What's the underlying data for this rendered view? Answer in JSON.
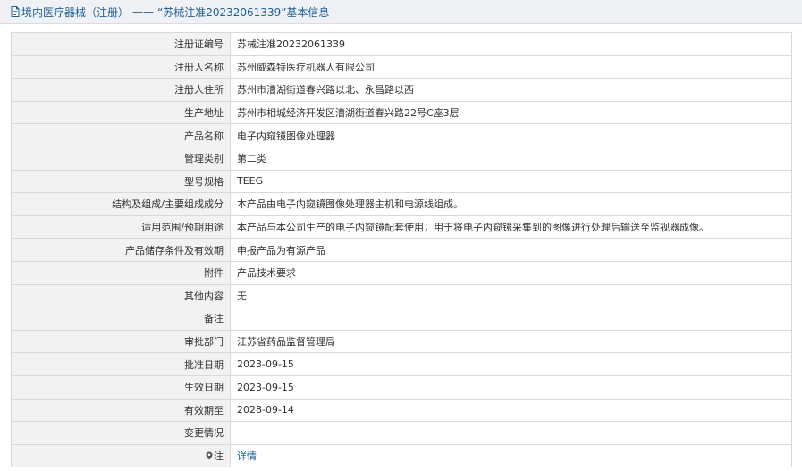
{
  "header": {
    "category": "境内医疗器械（注册）",
    "separator": "——",
    "title": "“苏械注准20232061339”基本信息",
    "icon": "document-icon"
  },
  "rows": [
    {
      "key": "registration-number",
      "label": "注册证编号",
      "value": "苏械注准20232061339"
    },
    {
      "key": "registrant-name",
      "label": "注册人名称",
      "value": "苏州威森特医疗机器人有限公司"
    },
    {
      "key": "registrant-address",
      "label": "注册人住所",
      "value": "苏州市漕湖街道春兴路以北、永昌路以西"
    },
    {
      "key": "production-address",
      "label": "生产地址",
      "value": "苏州市相城经济开发区漕湖街道春兴路22号C座3层"
    },
    {
      "key": "product-name",
      "label": "产品名称",
      "value": "电子内窥镜图像处理器"
    },
    {
      "key": "management-class",
      "label": "管理类别",
      "value": "第二类"
    },
    {
      "key": "model-spec",
      "label": "型号规格",
      "value": "TEEG"
    },
    {
      "key": "structure-composition",
      "label": "结构及组成/主要组成成分",
      "value": "本产品由电子内窥镜图像处理器主机和电源线组成。"
    },
    {
      "key": "intended-use",
      "label": "适用范围/预期用途",
      "value": "本产品与本公司生产的电子内窥镜配套使用，用于将电子内窥镜采集到的图像进行处理后输送至监视器成像。"
    },
    {
      "key": "storage-validity",
      "label": "产品储存条件及有效期",
      "value": "申报产品为有源产品"
    },
    {
      "key": "attachment",
      "label": "附件",
      "value": "产品技术要求"
    },
    {
      "key": "other-content",
      "label": "其他内容",
      "value": "无"
    },
    {
      "key": "remarks",
      "label": "备注",
      "value": ""
    },
    {
      "key": "approval-dept",
      "label": "审批部门",
      "value": "江苏省药品监督管理局"
    },
    {
      "key": "approval-date",
      "label": "批准日期",
      "value": "2023-09-15"
    },
    {
      "key": "effective-date",
      "label": "生效日期",
      "value": "2023-09-15"
    },
    {
      "key": "expiry-date",
      "label": "有效期至",
      "value": "2028-09-14"
    },
    {
      "key": "change-status",
      "label": "变更情况",
      "value": ""
    }
  ],
  "note": {
    "label": "注",
    "icon": "location-pin-icon",
    "link_text": "详情"
  }
}
